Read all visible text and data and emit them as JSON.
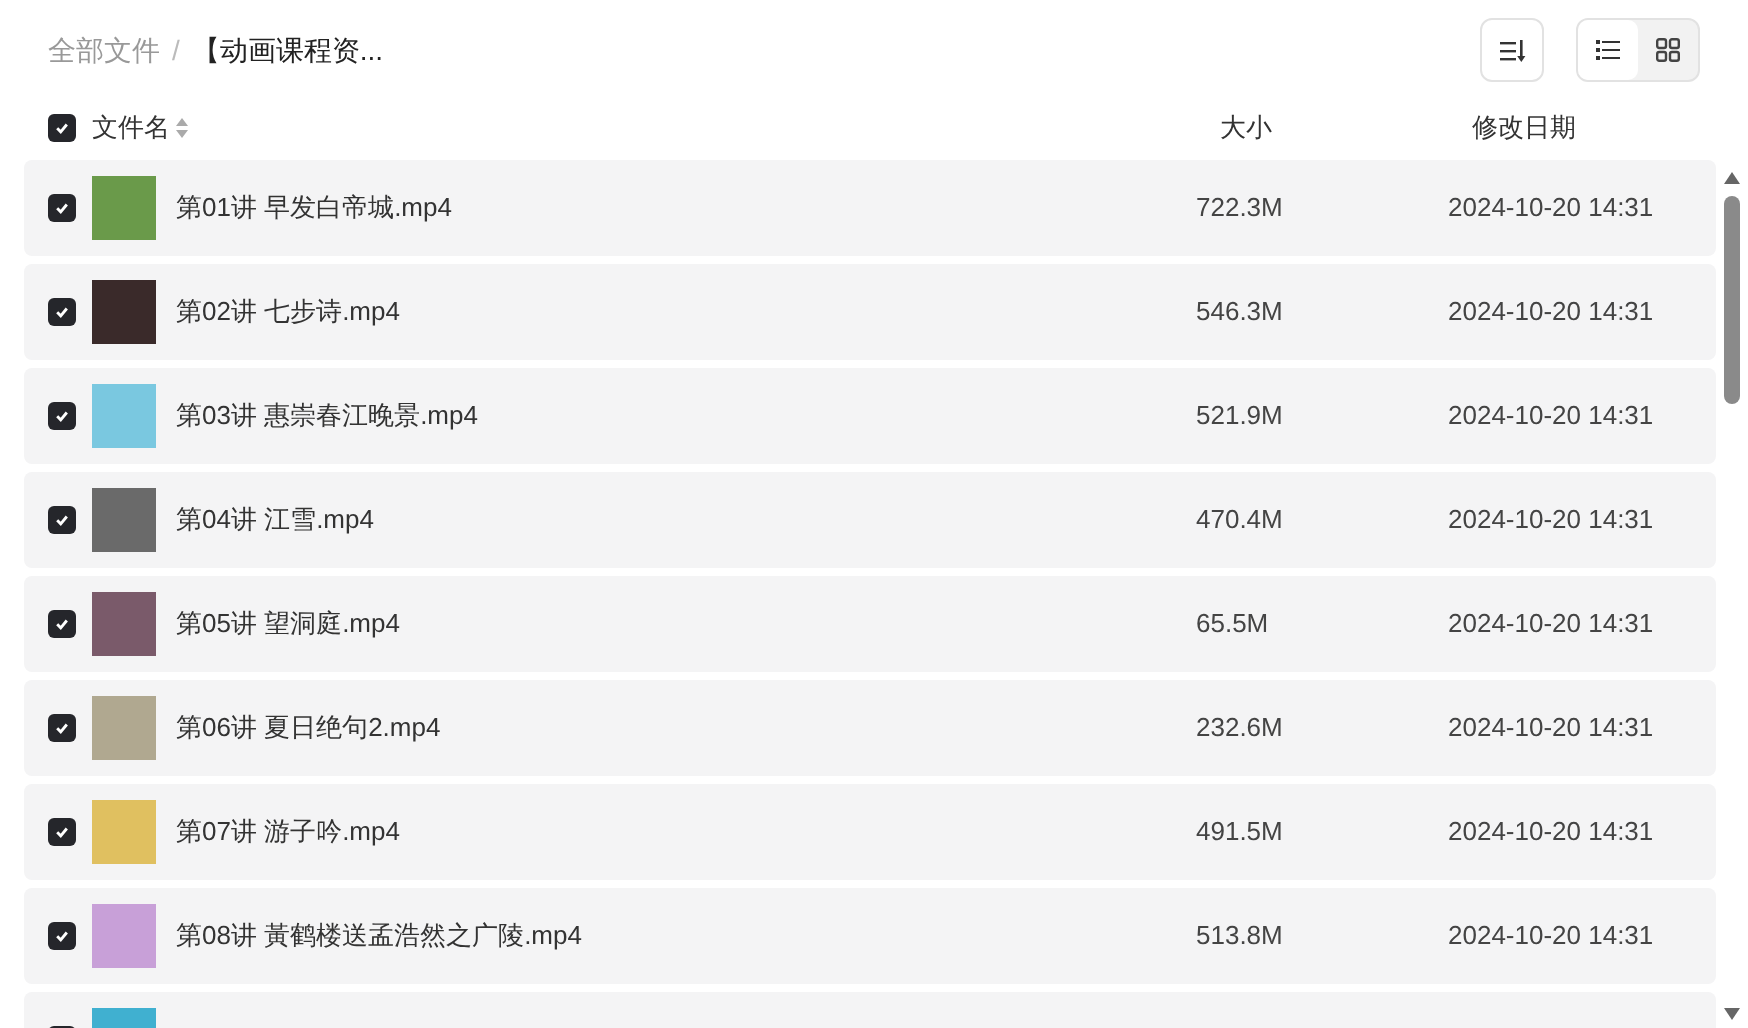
{
  "breadcrumb": [
    {
      "label": "全部文件"
    },
    {
      "label": "【动画课程资..."
    }
  ],
  "breadcrumb_separator": "/",
  "view_buttons": [
    {
      "kind": "list",
      "selected": true
    },
    {
      "kind": "grid",
      "selected": false
    }
  ],
  "header": {
    "checked": true,
    "columns": [
      {
        "label": "文件名",
        "kind": "sortable"
      },
      {
        "label": "大小",
        "kind": "plain"
      },
      {
        "label": "修改日期",
        "kind": "plain"
      }
    ]
  },
  "rows": [
    {
      "checked": true,
      "name": "第01讲 早发白帝城.mp4",
      "size": "722.3M",
      "date": "2024-10-20 14:31"
    },
    {
      "checked": true,
      "name": "第02讲 七步诗.mp4",
      "size": "546.3M",
      "date": "2024-10-20 14:31"
    },
    {
      "checked": true,
      "name": "第03讲 惠崇春江晚景.mp4",
      "size": "521.9M",
      "date": "2024-10-20 14:31"
    },
    {
      "checked": true,
      "name": "第04讲 江雪.mp4",
      "size": "470.4M",
      "date": "2024-10-20 14:31"
    },
    {
      "checked": true,
      "name": "第05讲 望洞庭.mp4",
      "size": "65.5M",
      "date": "2024-10-20 14:31"
    },
    {
      "checked": true,
      "name": "第06讲 夏日绝句2.mp4",
      "size": "232.6M",
      "date": "2024-10-20 14:31"
    },
    {
      "checked": true,
      "name": "第07讲 游子吟.mp4",
      "size": "491.5M",
      "date": "2024-10-20 14:31"
    },
    {
      "checked": true,
      "name": "第08讲 黃鹤楼送孟浩然之广陵.mp4",
      "size": "513.8M",
      "date": "2024-10-20 14:31"
    },
    {
      "checked": true
    }
  ]
}
